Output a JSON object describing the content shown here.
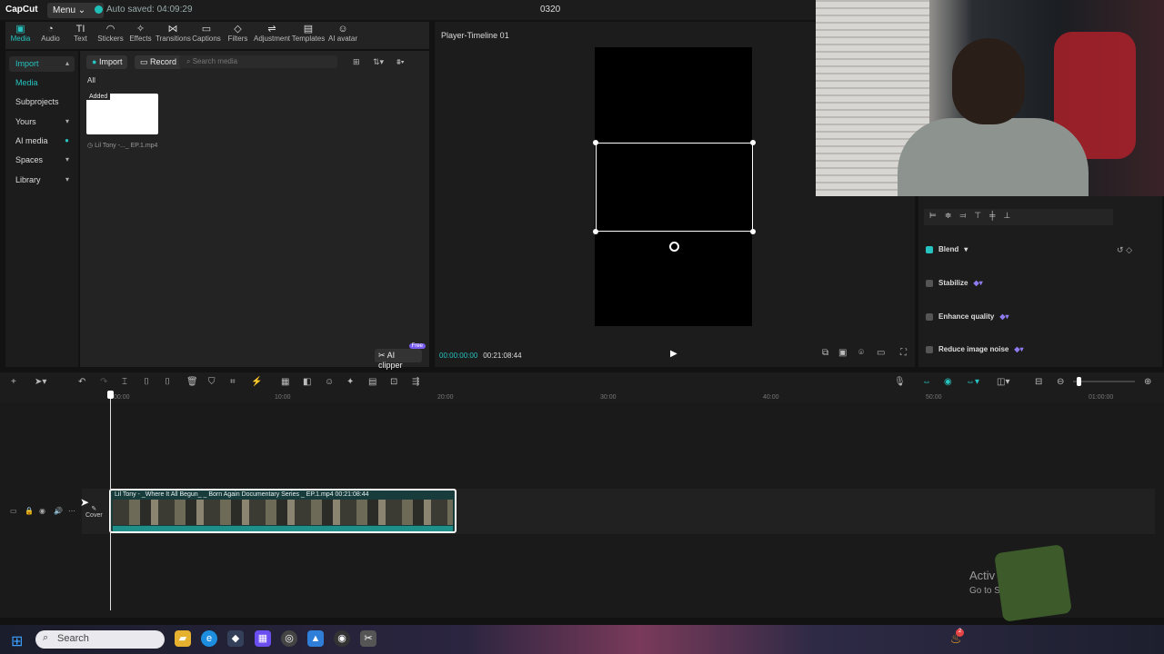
{
  "app": {
    "logo": "CapCut",
    "menu_label": "Menu ⌄",
    "autosave": "Auto saved: 04:09:29",
    "project_title": "0320"
  },
  "toolbar": {
    "tools": [
      {
        "label": "Media",
        "icon": "▣"
      },
      {
        "label": "Audio",
        "icon": "◔"
      },
      {
        "label": "Text",
        "icon": "TI"
      },
      {
        "label": "Stickers",
        "icon": "◠"
      },
      {
        "label": "Effects",
        "icon": "✧"
      },
      {
        "label": "Transitions",
        "icon": "⋈"
      },
      {
        "label": "Captions",
        "icon": "▭"
      },
      {
        "label": "Filters",
        "icon": "◇"
      },
      {
        "label": "Adjustment",
        "icon": "⇌"
      },
      {
        "label": "Templates",
        "icon": "▤"
      },
      {
        "label": "AI avatar",
        "icon": "☺"
      }
    ]
  },
  "leftnav": {
    "items": [
      "Import",
      "Media",
      "Subprojects",
      "Yours",
      "AI media",
      "Spaces",
      "Library"
    ]
  },
  "media": {
    "import_label": "Import",
    "record_label": "Record",
    "search_placeholder": "Search media",
    "filter_all": "All",
    "added_badge": "Added",
    "clip_name": "Lil Tony -..._ EP.1.mp4",
    "ai_clipper_label": "AI clipper",
    "free_badge": "Free"
  },
  "player": {
    "title": "Player-Timeline 01",
    "current_time": "00:00:00:00",
    "duration": "00:21:08:44"
  },
  "properties": {
    "blend": "Blend",
    "stabilize": "Stabilize",
    "enhance": "Enhance quality",
    "reduce_noise": "Reduce image noise"
  },
  "timeline": {
    "ticks": [
      "00:00",
      "10:00",
      "20:00",
      "30:00",
      "40:00",
      "50:00",
      "01:00:00"
    ],
    "clip_label": "Lil Tony - _Where It All Begun_ _ Born Again Documentary Series _ EP.1.mp4   00:21:08:44",
    "cover_label": "Cover"
  },
  "watermark": {
    "line1": "Activ",
    "line2": "Go to S                        Windows."
  },
  "taskbar": {
    "search_label": "Search",
    "notif_count": "2"
  },
  "colors": {
    "accent": "#26c4c0",
    "badge": "#7a5cf0"
  }
}
